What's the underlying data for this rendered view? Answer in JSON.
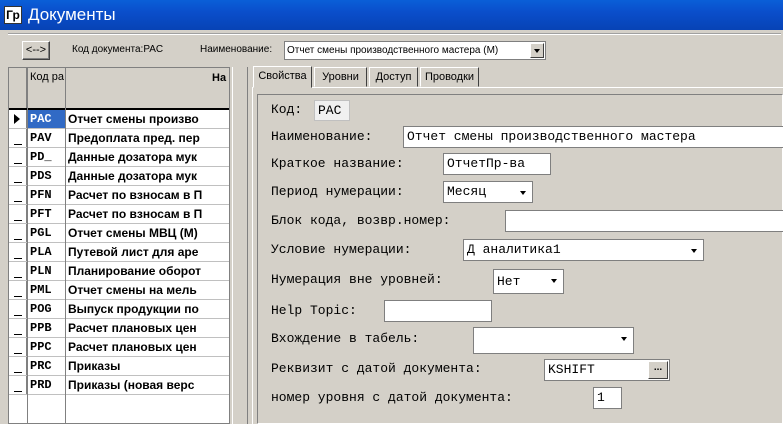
{
  "window": {
    "title": "Документы",
    "icon_letters": "Гр"
  },
  "toolbar": {
    "swap_label": "<-->",
    "code_label": "Код документа:PAC",
    "name_label": "Наименование:",
    "name_value": "Отчет смены производственного мастера (М)"
  },
  "grid": {
    "col_code_header": "Код ра",
    "col_name_header": "На",
    "selected_index": 0,
    "rows": [
      {
        "code": "PAC",
        "name": "Отчет смены произво"
      },
      {
        "code": "PAV",
        "name": "Предоплата пред. пер"
      },
      {
        "code": "PD_",
        "name": "Данные дозатора мук"
      },
      {
        "code": "PDS",
        "name": "Данные дозатора мук"
      },
      {
        "code": "PFN",
        "name": "Расчет по взносам в П"
      },
      {
        "code": "PFT",
        "name": "Расчет по взносам в П"
      },
      {
        "code": "PGL",
        "name": "Отчет смены МВЦ (М)"
      },
      {
        "code": "PLA",
        "name": "Путевой лист для аре"
      },
      {
        "code": "PLN",
        "name": "Планирование оборот"
      },
      {
        "code": "PML",
        "name": "Отчет смены на мель"
      },
      {
        "code": "POG",
        "name": "Выпуск продукции по"
      },
      {
        "code": "PPB",
        "name": "Расчет плановых цен"
      },
      {
        "code": "PPC",
        "name": "Расчет плановых цен"
      },
      {
        "code": "PRC",
        "name": "Приказы"
      },
      {
        "code": "PRD",
        "name": "Приказы (новая верс"
      }
    ]
  },
  "tabs": [
    {
      "label": "Свойства",
      "active": true
    },
    {
      "label": "Уровни",
      "active": false
    },
    {
      "label": "Доступ",
      "active": false
    },
    {
      "label": "Проводки",
      "active": false
    }
  ],
  "form": {
    "code_label": "Код:",
    "code_value": "PAC",
    "name_label": "Наименование:",
    "name_value": "Отчет смены производственного мастера",
    "short_label": "Краткое название:",
    "short_value": "ОтчетПр-ва",
    "period_label": "Период нумерации:",
    "period_value": "Месяц",
    "block_label": "Блок кода, возвр.номер:",
    "block_value": "",
    "cond_label": "Условие  нумерации:",
    "cond_value": "Д аналитика1",
    "outlevel_label": "Нумерация вне уровней:",
    "outlevel_value": "Нет",
    "help_label": "Help Topic:",
    "help_value": "",
    "tabel_label": "Вхождение  в табель:",
    "tabel_value": "",
    "req_label": "Реквизит с датой документа:",
    "req_value": "KSHIFT",
    "req_btn": "...",
    "level_label": "номер уровня с  датой документа:",
    "level_value": "1"
  }
}
